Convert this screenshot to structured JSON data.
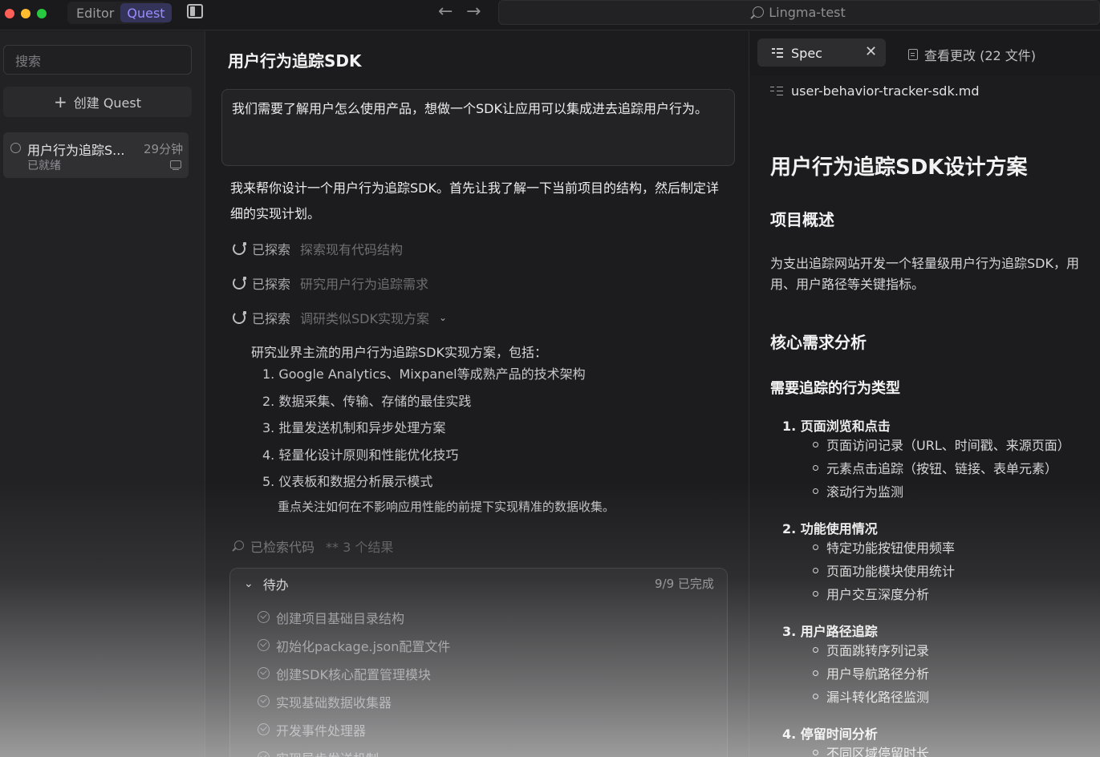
{
  "topbar": {
    "modes": [
      "Editor",
      "Quest"
    ],
    "active_mode": "Quest",
    "project_name": "Lingma-test",
    "back_glyph": "←",
    "forward_glyph": "→"
  },
  "sidebar": {
    "search_placeholder": "搜索",
    "create_label": "创建 Quest",
    "create_glyph": "+",
    "quests": [
      {
        "title": "用户行为追踪S...",
        "time": "29分钟",
        "status": "已就绪"
      }
    ]
  },
  "main": {
    "title": "用户行为追踪SDK",
    "user_message": "我们需要了解用户怎么使用产品，想做一个SDK让应用可以集成进去追踪用户行为。",
    "assistant_reply": "我来帮你设计一个用户行为追踪SDK。首先让我了解一下当前项目的结构，然后制定详细的实现计划。",
    "explore_steps": [
      {
        "label": "已探索",
        "desc": "探索现有代码结构"
      },
      {
        "label": "已探索",
        "desc": "研究用户行为追踪需求"
      },
      {
        "label": "已探索",
        "desc": "调研类似SDK实现方案",
        "expanded": true
      }
    ],
    "expand_glyph": "⌄",
    "research": {
      "intro": "研究业界主流的用户行为追踪SDK实现方案，包括：",
      "items": [
        "1. Google Analytics、Mixpanel等成熟产品的技术架构",
        "2. 数据采集、传输、存储的最佳实践",
        "3. 批量发送机制和异步处理方案",
        "4. 轻量化设计原则和性能优化技巧",
        "5. 仪表板和数据分析展示模式"
      ],
      "note": "重点关注如何在不影响应用性能的前提下实现精准的数据收集。"
    },
    "code_search": {
      "label": "已检索代码",
      "detail": "** 3 个结果"
    },
    "todo": {
      "title": "待办",
      "chevron": "⌄",
      "progress": "9/9 已完成",
      "items": [
        "创建项目基础目录结构",
        "初始化package.json配置文件",
        "创建SDK核心配置管理模块",
        "实现基础数据收集器",
        "开发事件处理器",
        "实现异步发送机制"
      ]
    }
  },
  "right": {
    "spec_tab_label": "Spec",
    "close_glyph": "✕",
    "changes_tab_label": "查看更改 (22 文件)",
    "file_name": "user-behavior-tracker-sdk.md",
    "doc": {
      "h1": "用户行为追踪SDK设计方案",
      "overview_heading": "项目概述",
      "overview_lines": [
        "为支出追踪网站开发一个轻量级用户行为追踪SDK，用",
        "用、用户路径等关键指标。"
      ],
      "analysis_heading": "核心需求分析",
      "types_heading": "需要追踪的行为类型",
      "groups": [
        {
          "title": "1. 页面浏览和点击",
          "items": [
            "页面访问记录（URL、时间戳、来源页面）",
            "元素点击追踪（按钮、链接、表单元素）",
            "滚动行为监测"
          ]
        },
        {
          "title": "2. 功能使用情况",
          "items": [
            "特定功能按钮使用频率",
            "页面功能模块使用统计",
            "用户交互深度分析"
          ]
        },
        {
          "title": "3. 用户路径追踪",
          "items": [
            "页面跳转序列记录",
            "用户导航路径分析",
            "漏斗转化路径监测"
          ]
        },
        {
          "title": "4. 停留时间分析",
          "items": [
            "不同区域停留时长"
          ]
        }
      ]
    }
  },
  "colors": {
    "accent": "#9a8cff",
    "background": "#1c1c1e",
    "sidebar": "#222224",
    "traffic_red": "#ff5f57",
    "traffic_yellow": "#febc2e",
    "traffic_green": "#28c840"
  }
}
